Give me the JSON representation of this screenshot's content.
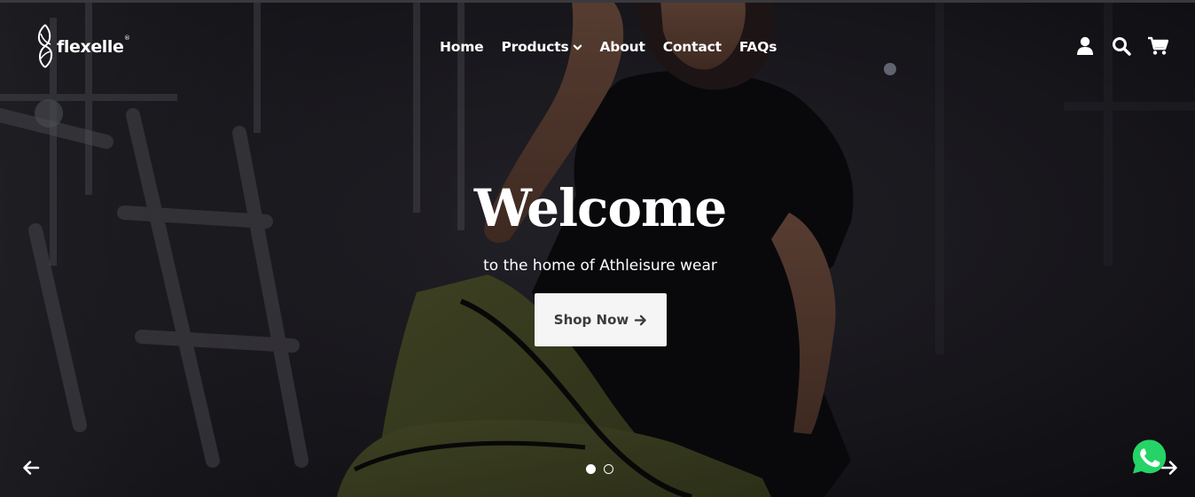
{
  "brand": {
    "name": "flexelle",
    "registered_mark": "®"
  },
  "nav": {
    "items": [
      {
        "label": "Home",
        "has_dropdown": false
      },
      {
        "label": "Products",
        "has_dropdown": true
      },
      {
        "label": "About",
        "has_dropdown": false
      },
      {
        "label": "Contact",
        "has_dropdown": false
      },
      {
        "label": "FAQs",
        "has_dropdown": false
      }
    ]
  },
  "header_icons": [
    "user-icon",
    "search-icon",
    "cart-icon"
  ],
  "hero": {
    "title": "Welcome",
    "subtitle": "to the home of Athleisure wear",
    "cta_label": "Shop Now",
    "cta_icon": "arrow-right-icon"
  },
  "slider": {
    "slide_count": 2,
    "active_slide": 1
  },
  "floating": {
    "chat_icon": "whatsapp-icon",
    "chat_color": "#25d366"
  },
  "colors": {
    "overlay_text": "#ffffff",
    "button_bg": "#f5f5f5",
    "button_text": "#3b3b3b"
  }
}
